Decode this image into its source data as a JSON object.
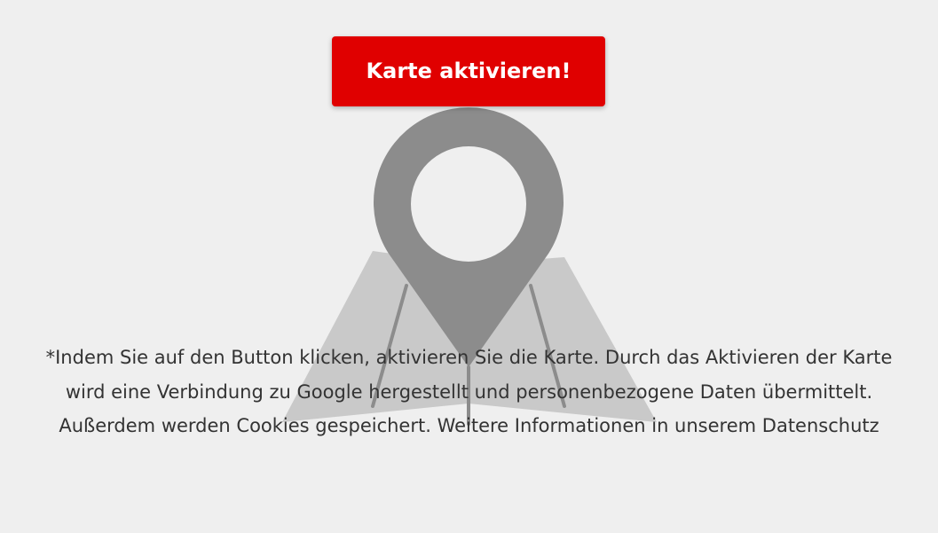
{
  "colors": {
    "background": "#efefef",
    "button_background": "#e00000",
    "button_text": "#ffffff",
    "text": "#333333",
    "map_light": "#c9c9c9",
    "map_lines": "#8c8c8c",
    "pin": "#8c8c8c"
  },
  "map_placeholder": {
    "illustration_icon": "map-with-location-pin-icon",
    "activate_button_label": "Karte aktivieren!",
    "consent_text": "*Indem Sie auf den Button klicken, aktivieren Sie die Karte. Durch das Aktivieren der Karte wird eine Verbindung zu Google hergestellt und personenbezogene Daten übermittelt. Außerdem werden Cookies gespeichert. Weitere Informationen in unserem",
    "privacy_link_label": "Datenschutz"
  }
}
